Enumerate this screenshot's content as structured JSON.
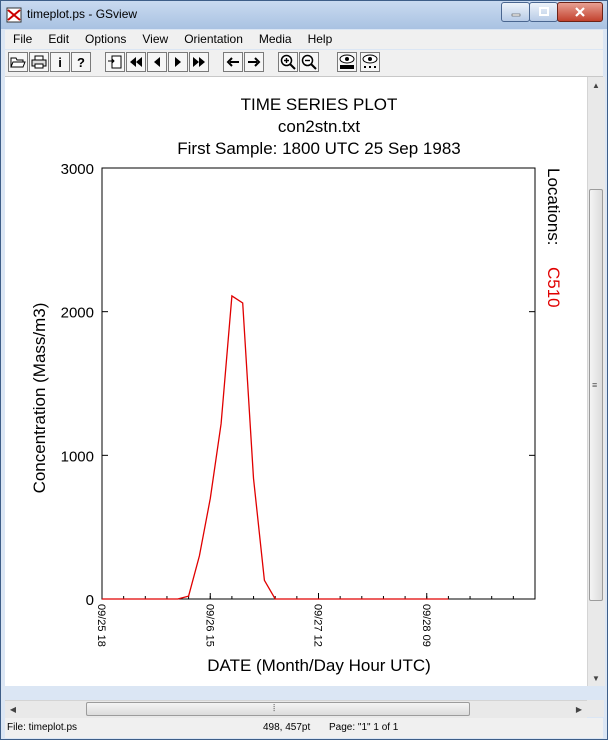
{
  "window": {
    "title": "timeplot.ps - GSview",
    "buttons": {
      "minimize": "minimize-icon",
      "maximize": "maximize-icon",
      "close": "close-icon"
    }
  },
  "menu": [
    "File",
    "Edit",
    "Options",
    "View",
    "Orientation",
    "Media",
    "Help"
  ],
  "toolbar": {
    "icons": [
      "open-icon",
      "print-icon",
      "info-icon",
      "help-icon",
      "goto-page-icon",
      "first-page-icon",
      "prev-page-icon",
      "next-page-icon",
      "last-page-icon",
      "back-icon",
      "forward-icon",
      "zoom-in-icon",
      "zoom-out-icon",
      "text-extract-icon",
      "find-icon"
    ],
    "info_glyph": "i",
    "help_glyph": "?"
  },
  "plot": {
    "title1": "TIME SERIES PLOT",
    "title2": "con2stn.txt",
    "title3": "First Sample: 1800 UTC 25 Sep 1983",
    "locations_label": "Locations:",
    "location": "C510",
    "line_color": "#e00000"
  },
  "chart_data": {
    "type": "line",
    "xlabel": "DATE (Month/Day Hour UTC)",
    "ylabel": "Concentration (Mass/m3)",
    "ylim": [
      0,
      3000
    ],
    "xlim": [
      0,
      120
    ],
    "yticks": [
      {
        "value": 0,
        "label": "0"
      },
      {
        "value": 1000,
        "label": "1000"
      },
      {
        "value": 2000,
        "label": "2000"
      },
      {
        "value": 3000,
        "label": "3000"
      }
    ],
    "xticks": [
      {
        "value": 0,
        "label": "09/25 18"
      },
      {
        "value": 30,
        "label": "09/26 15"
      },
      {
        "value": 60,
        "label": "09/27 12"
      },
      {
        "value": 90,
        "label": "09/28 09"
      }
    ],
    "series": [
      {
        "name": "C510",
        "x": [
          0,
          3,
          6,
          9,
          12,
          15,
          18,
          21,
          24,
          27,
          30,
          33,
          36,
          39,
          42,
          45,
          48,
          51,
          54,
          57,
          60,
          63,
          66,
          69,
          72,
          75,
          78,
          81,
          84,
          87,
          90,
          93,
          96
        ],
        "values": [
          0,
          0,
          0,
          0,
          0,
          0,
          0,
          0,
          20,
          300,
          700,
          1220,
          2110,
          2060,
          840,
          130,
          0,
          0,
          0,
          0,
          0,
          0,
          0,
          0,
          0,
          0,
          0,
          0,
          0,
          0,
          0,
          0,
          0
        ]
      }
    ],
    "grid": false,
    "legend": "right"
  },
  "scroll": {
    "hthumb_glyph": "⦙",
    "vthumb_glyph": "≡"
  },
  "status": {
    "file": "File: timeplot.ps",
    "coords": "498, 457pt",
    "page": "Page: \"1\"  1 of 1"
  }
}
